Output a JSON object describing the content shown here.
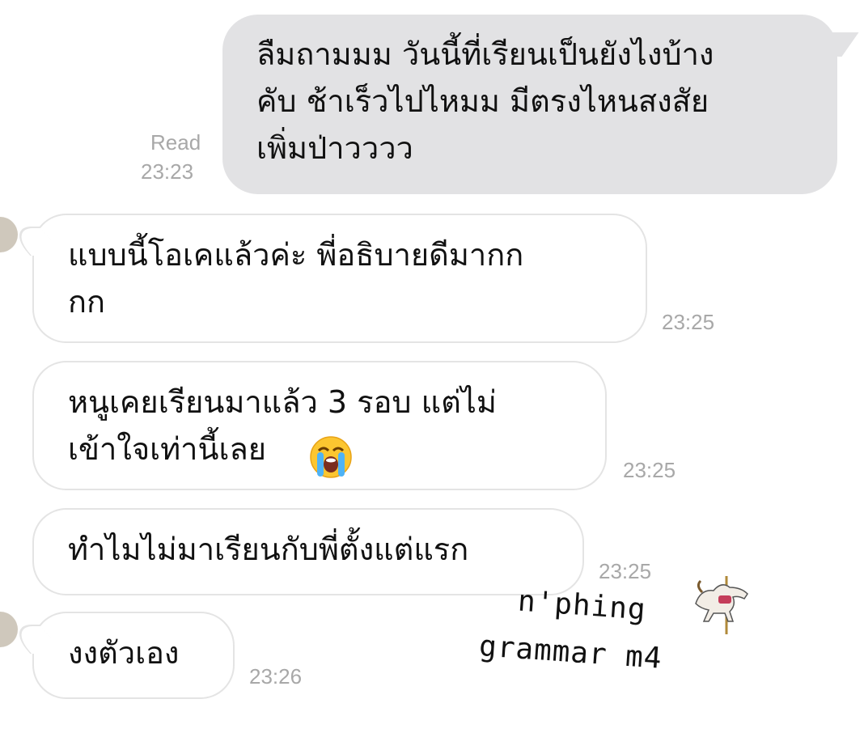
{
  "messages": [
    {
      "side": "sent",
      "text": "ลืมถามมม วันนี้ที่เรียนเป็นยังไงบ้าง\nคับ ช้าเร็วไปไหมม มีตรงไหนสงสัย\nเพิ่มป่าวววว",
      "status": "Read",
      "time": "23:23"
    },
    {
      "side": "received",
      "text": "แบบนี้โอเคแล้วค่ะ พี่อธิบายดีมากก\nกก",
      "time": "23:25"
    },
    {
      "side": "received",
      "text": "หนูเคยเรียนมาแล้ว 3 รอบ แต่ไม่\nเข้าใจเท่านี้เลย",
      "emoji": "loudly-crying-face",
      "time": "23:25"
    },
    {
      "side": "received",
      "text": "ทำไมไม่มาเรียนกับพี่ตั้งแต่แรก",
      "time": "23:25"
    },
    {
      "side": "received",
      "text": "งงตัวเอง",
      "time": "23:26"
    }
  ],
  "watermark": {
    "line1": "n'phing",
    "line2": "grammar m4",
    "icon": "carousel-horse-icon"
  },
  "colors": {
    "sent_bubble": "#e2e2e4",
    "received_border": "#e4e4e4",
    "meta_text": "#a8a8a8"
  }
}
